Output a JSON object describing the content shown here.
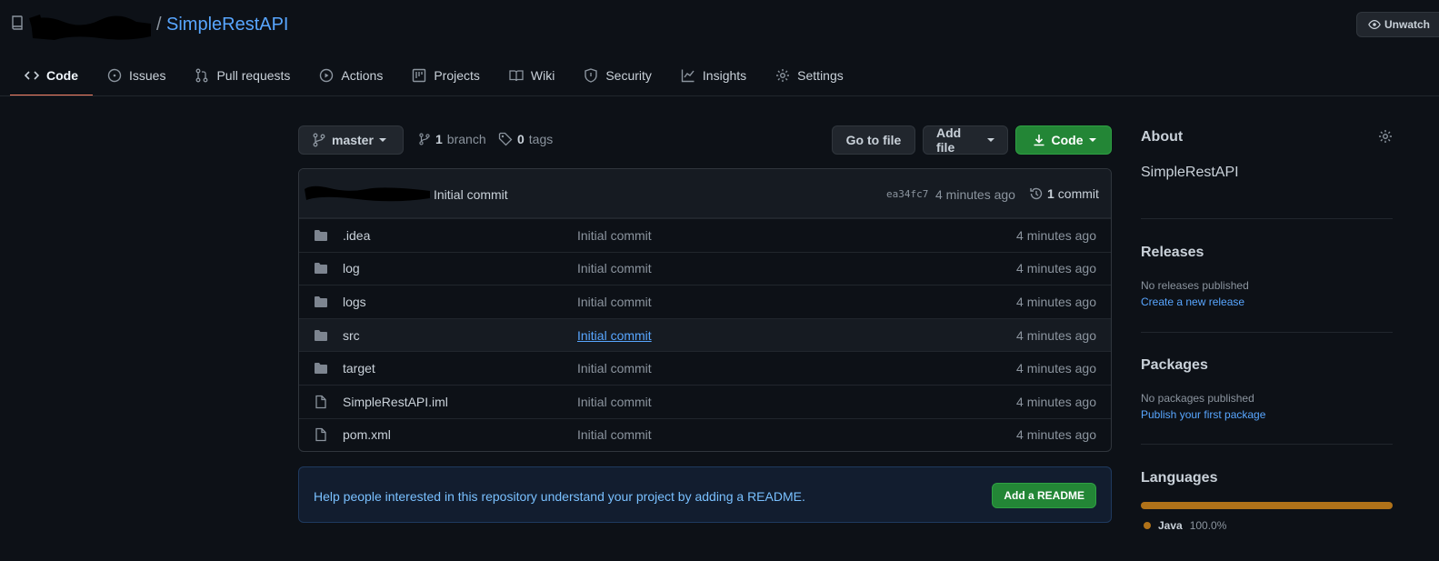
{
  "header": {
    "slash": "/",
    "repo_name": "SimpleRestAPI",
    "unwatch_label": "Unwatch"
  },
  "tabs": [
    {
      "label": "Code",
      "icon": "code-icon",
      "active": true
    },
    {
      "label": "Issues",
      "icon": "issue-icon"
    },
    {
      "label": "Pull requests",
      "icon": "pull-request-icon"
    },
    {
      "label": "Actions",
      "icon": "play-icon"
    },
    {
      "label": "Projects",
      "icon": "project-icon"
    },
    {
      "label": "Wiki",
      "icon": "book-icon"
    },
    {
      "label": "Security",
      "icon": "shield-icon"
    },
    {
      "label": "Insights",
      "icon": "graph-icon"
    },
    {
      "label": "Settings",
      "icon": "gear-icon"
    }
  ],
  "toolbar": {
    "branch_name": "master",
    "branch_count": "1",
    "branch_label": "branch",
    "tags_count": "0",
    "tags_label": "tags",
    "go_to_file": "Go to file",
    "add_file": "Add file",
    "code": "Code"
  },
  "latest_commit": {
    "message": "Initial commit",
    "sha": "ea34fc7",
    "time": "4 minutes ago",
    "count": "1",
    "count_label": "commit"
  },
  "files": [
    {
      "name": ".idea",
      "type": "dir",
      "message": "Initial commit",
      "age": "4 minutes ago"
    },
    {
      "name": "log",
      "type": "dir",
      "message": "Initial commit",
      "age": "4 minutes ago"
    },
    {
      "name": "logs",
      "type": "dir",
      "message": "Initial commit",
      "age": "4 minutes ago"
    },
    {
      "name": "src",
      "type": "dir",
      "message": "Initial commit",
      "age": "4 minutes ago"
    },
    {
      "name": "target",
      "type": "dir",
      "message": "Initial commit",
      "age": "4 minutes ago"
    },
    {
      "name": "SimpleRestAPI.iml",
      "type": "file",
      "message": "Initial commit",
      "age": "4 minutes ago"
    },
    {
      "name": "pom.xml",
      "type": "file",
      "message": "Initial commit",
      "age": "4 minutes ago"
    }
  ],
  "readme_banner": {
    "text": "Help people interested in this repository understand your project by adding a README.",
    "button": "Add a README"
  },
  "sidebar": {
    "about_title": "About",
    "description": "SimpleRestAPI",
    "releases_title": "Releases",
    "releases_none": "No releases published",
    "releases_link": "Create a new release",
    "packages_title": "Packages",
    "packages_none": "No packages published",
    "packages_link": "Publish your first package",
    "languages_title": "Languages",
    "languages": [
      {
        "name": "Java",
        "percent": "100.0%",
        "color": "#b07219"
      }
    ]
  },
  "colors": {
    "background": "#0d1117",
    "accent_link": "#58a6ff",
    "primary_button": "#238636",
    "active_tab_underline": "#f78166"
  }
}
